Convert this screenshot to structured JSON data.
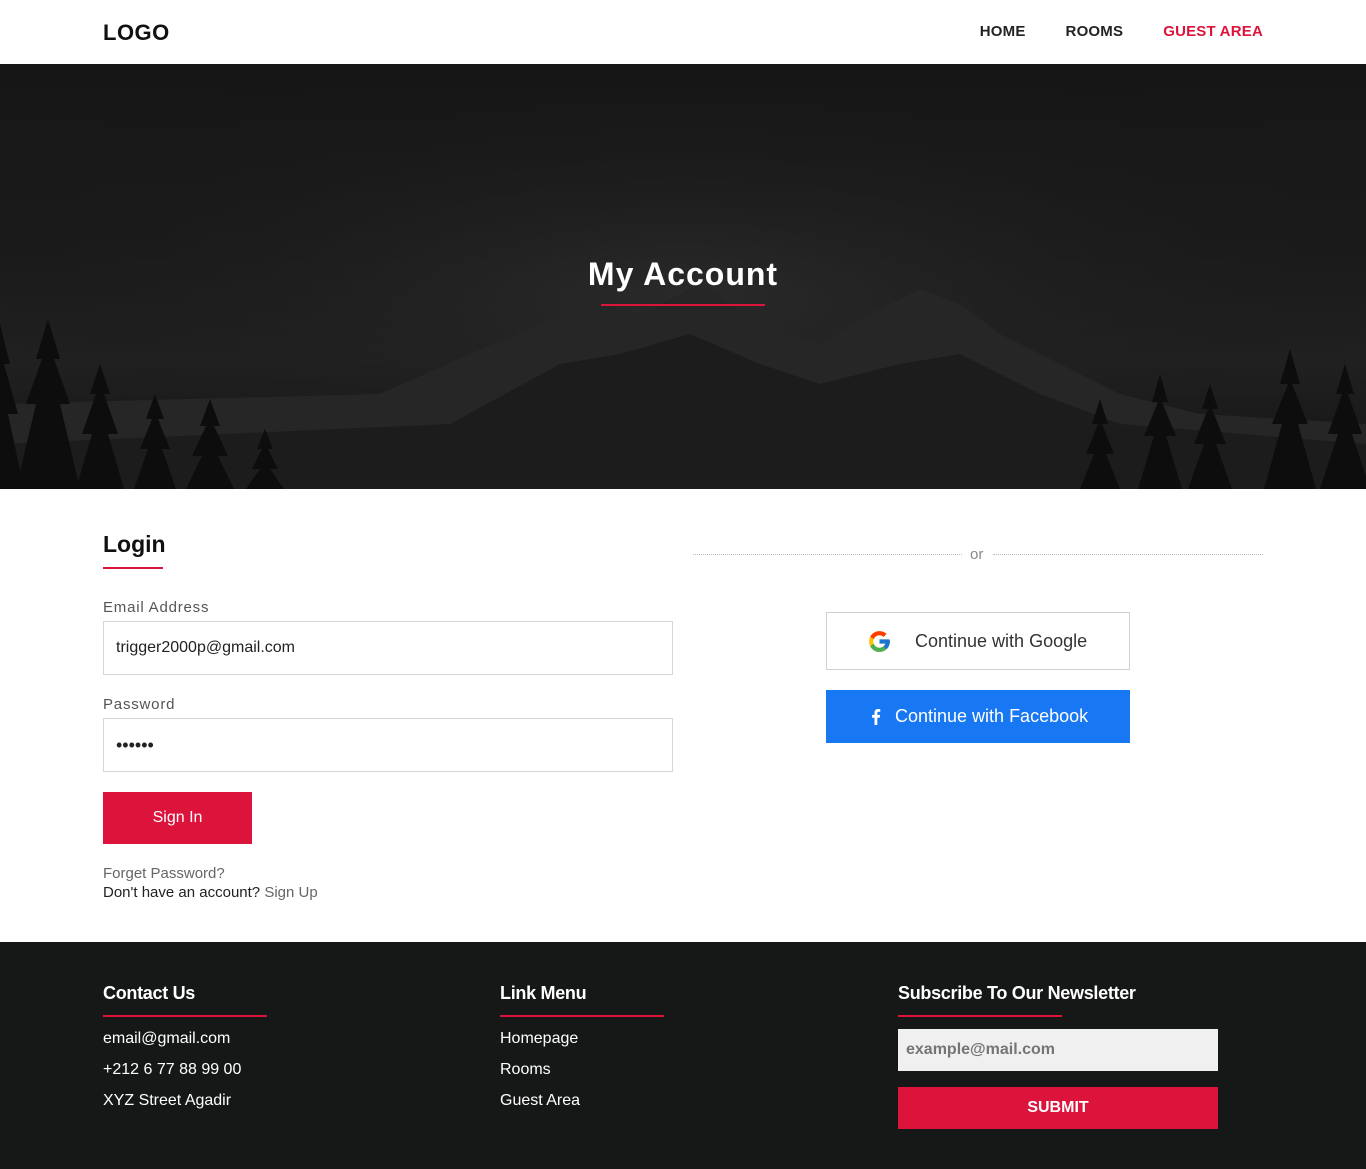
{
  "header": {
    "logo": "LOGO",
    "nav": [
      {
        "label": "HOME",
        "active": false
      },
      {
        "label": "ROOMS",
        "active": false
      },
      {
        "label": "GUEST AREA",
        "active": true
      }
    ]
  },
  "hero": {
    "title": "My Account"
  },
  "login": {
    "title": "Login",
    "email_label": "Email Address",
    "email_value": "trigger2000p@gmail.com",
    "password_label": "Password",
    "password_value": "••••••",
    "signin_label": "Sign In",
    "forgot_label": "Forget Password?",
    "no_account_text": "Don't have an account?",
    "signup_label": "Sign Up"
  },
  "social": {
    "or_text": "or",
    "google_label": "Continue with Google",
    "facebook_label": "Continue with Facebook"
  },
  "footer": {
    "contact": {
      "title": "Contact Us",
      "items": [
        "email@gmail.com",
        "+212 6 77 88 99 00",
        "XYZ Street Agadir"
      ]
    },
    "links": {
      "title": "Link Menu",
      "items": [
        "Homepage",
        "Rooms",
        "Guest Area"
      ]
    },
    "newsletter": {
      "title": "Subscribe To Our Newsletter",
      "placeholder": "example@mail.com",
      "submit_label": "SUBMIT"
    }
  },
  "colors": {
    "accent": "#dc143c",
    "facebook": "#1877f2",
    "footer_bg": "#161818"
  }
}
